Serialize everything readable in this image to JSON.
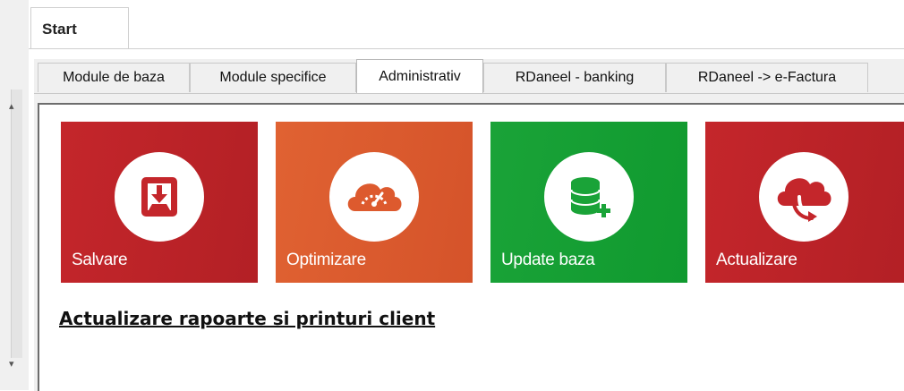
{
  "start_tab": {
    "label": "Start"
  },
  "tabs": [
    {
      "label": "Module de baza",
      "active": false
    },
    {
      "label": "Module specifice",
      "active": false
    },
    {
      "label": "Administrativ",
      "active": true
    },
    {
      "label": "RDaneel - banking",
      "active": false
    },
    {
      "label": "RDaneel -> e-Factura",
      "active": false
    }
  ],
  "tiles": [
    {
      "label": "Salvare",
      "icon": "download-save-icon",
      "color": "#c4262b"
    },
    {
      "label": "Optimizare",
      "icon": "cloud-speedometer-icon",
      "color": "#dd5a2e"
    },
    {
      "label": "Update baza",
      "icon": "database-add-icon",
      "color": "#1aa338"
    },
    {
      "label": "Actualizare",
      "icon": "cloud-download-icon",
      "color": "#c4262b"
    }
  ],
  "link": {
    "label": "Actualizare rapoarte si printuri client"
  }
}
